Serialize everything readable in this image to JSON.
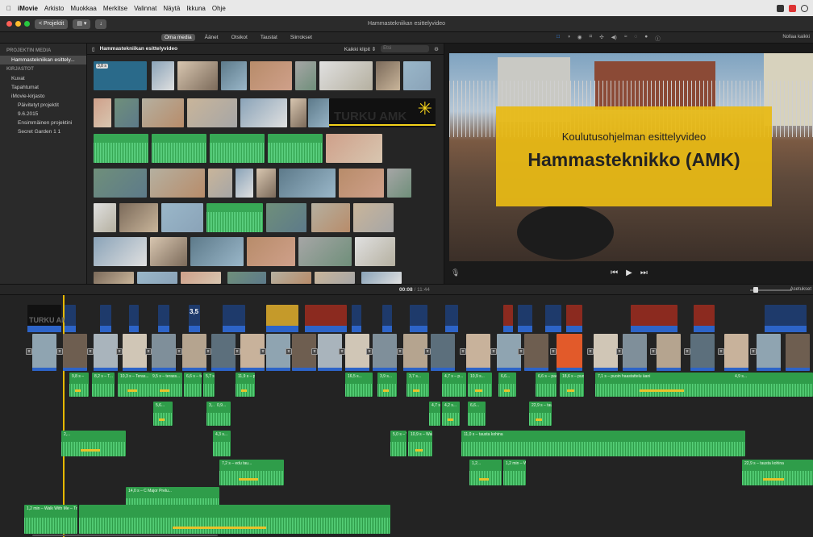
{
  "menubar": {
    "apple": "",
    "items": [
      "iMovie",
      "Arkisto",
      "Muokkaa",
      "Merkitse",
      "Valinnat",
      "Näytä",
      "Ikkuna",
      "Ohje"
    ]
  },
  "window": {
    "back_label": "< Projektit",
    "title": "Hammastekniikan esittelyvideo"
  },
  "media_tabs": [
    "Oma media",
    "Äänet",
    "Otsikot",
    "Taustat",
    "Siirrokset"
  ],
  "viewer_tools": [
    "□",
    "◑",
    "◉",
    "⌗",
    "✣",
    "◀)",
    "≈",
    "◌",
    "●",
    "ⓘ"
  ],
  "reset_label": "Nollaa kaikki",
  "sidebar": {
    "project_media_header": "PROJEKTIN MEDIA",
    "project_item": "Hammastekniikan esittely...",
    "libraries_header": "KIRJASTOT",
    "items": [
      "Kuvat",
      "Tapahtumat",
      "iMovie-kirjasto",
      "Päivitetyt projektit",
      "9.6.2015",
      "Ensimmäinen projektini",
      "Secret Garden 1 1"
    ]
  },
  "browser": {
    "title": "Hammastekniikan esittelyvideo",
    "filter": "Kaikki klipit ⇕",
    "search_placeholder": "Etsi",
    "logo_text": "TURKU AMK",
    "thumb_badge": "3,8 s"
  },
  "viewer": {
    "subtitle": "Koulutusohjelman esittelyvideo",
    "title": "Hammasteknikko (AMK)",
    "prev": "⏮",
    "play": "▶",
    "next": "⏭",
    "mic": "🎙"
  },
  "timeline_header": {
    "timecode": "00:08",
    "total": "/ 11:44",
    "adjust": "Asetukset"
  },
  "timeline": {
    "tc_overlay": "3,5",
    "audio_labels": [
      "9,8 s –",
      "8,2 s – T...",
      "10,3 s – Teras...",
      "9,5 s – terass...",
      "6,6 s – te...",
      "5,7 s...",
      "11,9 s – pun",
      "16,5 s...",
      "3,9 s...",
      "3,7 s...",
      "4,7 s – p...",
      "10,9 s...",
      "6,6...",
      "6,6 s – pac...",
      "18,6 s – puoin haastattelu äani",
      "7,1 s – puoin haastattelu äani",
      "4,9 s...",
      "5,6...",
      "3,...",
      "0,9...",
      "4,7 s...",
      "4,2 s...",
      "6,6...",
      "22,9 s – tausta kohina",
      "2,...",
      "4,3 s...",
      "5,0 s – W...",
      "10,9 s – Walk With Me – TrackTribe",
      "11,0 s – tausta kohina",
      "7,2 s – edu tau...",
      "1,2...",
      "1,2 min – Walk With Me – TrackTribe",
      "22,9 s – tausta kohina",
      "14,0 s – C Major Prelu...",
      "1,2 min – Walk With Me – TrackTribe"
    ]
  },
  "colors": {
    "accent_blue": "#3a8ef5",
    "audio_green": "#2f9d4a",
    "title_yellow": "#e8ba14",
    "playhead": "#e6b800"
  }
}
